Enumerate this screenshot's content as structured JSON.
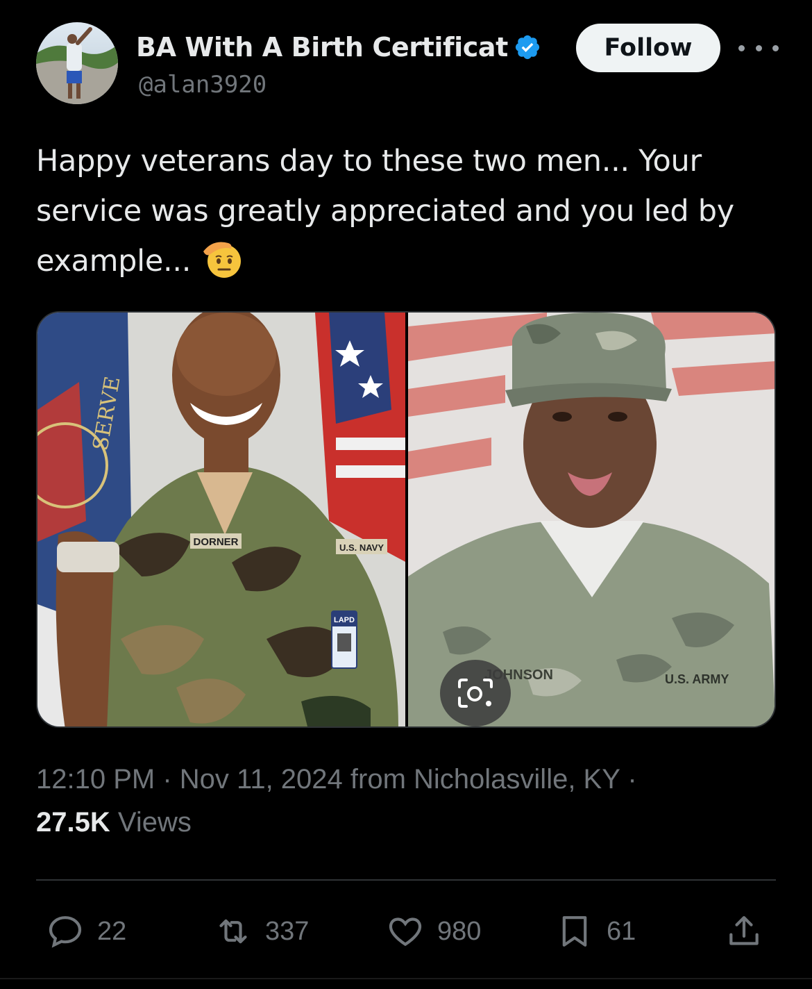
{
  "author": {
    "display_name": "BA With A Birth Certificat",
    "handle": "@alan3920",
    "verified_icon": "verified-badge-icon",
    "follow_label": "Follow"
  },
  "tweet": {
    "text": "Happy veterans day to these two men... Your service was greatly appreciated and you led by example...",
    "emoji": "saluting-face"
  },
  "media": {
    "left_photo": {
      "name_tape": "DORNER",
      "branch_tape": "U.S. NAVY",
      "badge_text": "LAPD",
      "flag_text": "SERVE"
    },
    "right_photo": {
      "name_tape": "JOHNSON",
      "branch_tape": "U.S. ARMY"
    },
    "lens_icon": "visual-search-icon"
  },
  "meta": {
    "time": "12:10 PM",
    "date": "Nov 11, 2024",
    "source": "from Nicholasville, KY",
    "separator": "·",
    "views_count": "27.5K",
    "views_label": "Views"
  },
  "actions": {
    "replies": "22",
    "reposts": "337",
    "likes": "980",
    "bookmarks": "61"
  },
  "colors": {
    "background": "#000000",
    "text": "#e7e9ea",
    "secondary": "#71767b",
    "verified": "#1d9bf0",
    "follow_bg": "#eff3f4"
  }
}
